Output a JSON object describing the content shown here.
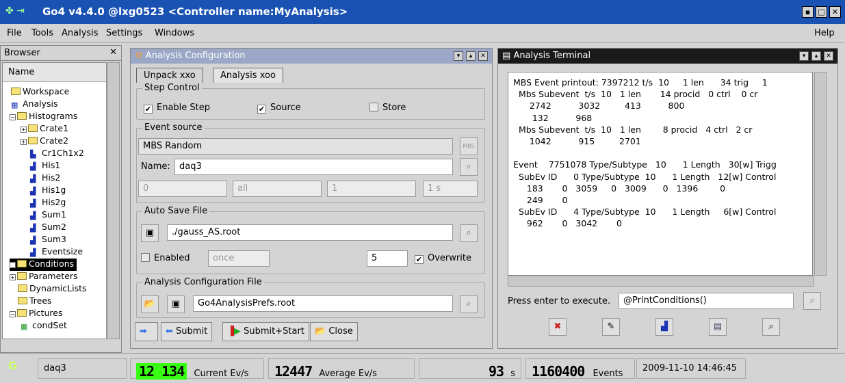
{
  "window": {
    "title": "Go4 v4.4.0 @lxg0523 <Controller name:MyAnalysis>"
  },
  "menu": {
    "file": "File",
    "tools": "Tools",
    "analysis": "Analysis",
    "settings": "Settings",
    "windows": "Windows",
    "help": "Help"
  },
  "browser": {
    "title": "Browser",
    "column": "Name",
    "items": [
      "Workspace",
      "Analysis",
      "Histograms",
      "Crate1",
      "Crate2",
      "Cr1Ch1x2",
      "His1",
      "His2",
      "His1g",
      "His2g",
      "Sum1",
      "Sum2",
      "Sum3",
      "Eventsize",
      "Conditions",
      "Parameters",
      "DynamicLists",
      "Trees",
      "Pictures",
      "condSet"
    ]
  },
  "aconf": {
    "title": "Analysis Configuration",
    "tab1": "Unpack xxo",
    "tab2": "Analysis xoo",
    "step_control": "Step Control",
    "enable_step": "Enable Step",
    "source": "Source",
    "store": "Store",
    "event_source": "Event source",
    "source_type": "MBS Random",
    "mbs_btn": "MBS",
    "name_label": "Name:",
    "name_value": "daq3",
    "spin1": "0",
    "spin2": "all",
    "spin3": "1",
    "spin4": "1 s",
    "auto_save": "Auto Save File",
    "autosave_file": "./gauss_AS.root",
    "enabled": "Enabled",
    "once": "once",
    "number": "5",
    "overwrite": "Overwrite",
    "config_file_label": "Analysis Configuration File",
    "config_file": "Go4AnalysisPrefs.root",
    "submit": "Submit",
    "submit_start": "Submit+Start",
    "close": "Close"
  },
  "terminal": {
    "title": "Analysis Terminal",
    "lines": [
      "MBS Event printout: 7397212 t/s  10     1 len      34 trig     1",
      "  Mbs Subevent  t/s  10   1 len       14 procid   0 ctrl    0 cr",
      "      2742          3032         413          800",
      "       132          968",
      "  Mbs Subevent  t/s  10   1 len        8 procid   4 ctrl   2 cr",
      "      1042          915         2701",
      "",
      "Event    7751078 Type/Subtype   10      1 Length   30[w] Trigg",
      "  SubEv ID      0 Type/Subtype  10      1 Length   12[w] Control",
      "     183       0   3059     0   3009      0   1396        0",
      "     249       0",
      "  SubEv ID      4 Type/Subtype  10      1 Length     6[w] Control",
      "     962       0   3042       0"
    ],
    "press_label": "Press enter to execute.",
    "command": "@PrintConditions()"
  },
  "status": {
    "name": "daq3",
    "current_rate": "12 134",
    "current_label": "Current Ev/s",
    "avg_rate": "12447",
    "avg_label": "Average Ev/s",
    "seconds": "93",
    "s_label": "s",
    "events": "1160400",
    "events_label": "Events",
    "datetime": "2009-11-10 14:46:45"
  },
  "colors": {
    "titlebar": "#1a52b3",
    "lcd_green": "#39ff14"
  }
}
